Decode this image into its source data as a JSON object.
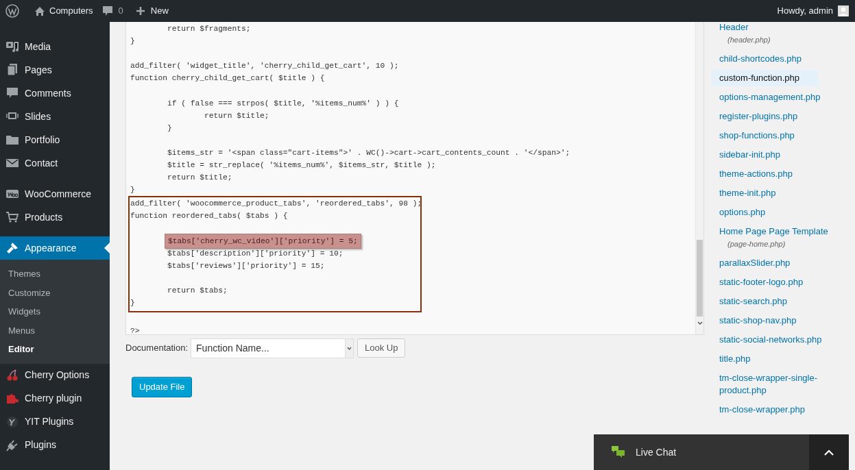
{
  "admin_bar": {
    "site": "Computers",
    "comments": "0",
    "new": "New",
    "greeting": "Howdy, admin"
  },
  "sidebar": {
    "groups": [
      [
        {
          "label": "Media",
          "selected": false
        },
        {
          "label": "Pages",
          "selected": false
        },
        {
          "label": "Comments",
          "selected": false
        },
        {
          "label": "Slides",
          "selected": false
        },
        {
          "label": "Portfolio",
          "selected": false
        },
        {
          "label": "Contact",
          "selected": false
        }
      ],
      [
        {
          "label": "WooCommerce",
          "selected": false
        },
        {
          "label": "Products",
          "selected": false
        }
      ],
      [
        {
          "label": "Appearance",
          "selected": true,
          "children": [
            {
              "label": "Themes",
              "selected": false
            },
            {
              "label": "Customize",
              "selected": false
            },
            {
              "label": "Widgets",
              "selected": false
            },
            {
              "label": "Menus",
              "selected": false
            },
            {
              "label": "Editor",
              "selected": true
            }
          ]
        },
        {
          "label": "Cherry Options",
          "selected": false
        },
        {
          "label": "Cherry plugin",
          "selected": false
        },
        {
          "label": "YIT Plugins",
          "selected": false
        },
        {
          "label": "Plugins",
          "selected": false
        }
      ]
    ]
  },
  "editor": {
    "lines_before": [
      {
        "kind": "code",
        "text": "\treturn $fragments;"
      },
      {
        "kind": "code",
        "text": "}"
      },
      {
        "kind": "blank"
      },
      {
        "kind": "code",
        "text": "add_filter( 'widget_title', 'cherry_child_get_cart', 10 );"
      },
      {
        "kind": "code",
        "text": "function cherry_child_get_cart( $title ) {"
      },
      {
        "kind": "blank"
      },
      {
        "kind": "code",
        "text": "\tif ( false === strpos( $title, '%items_num%' ) ) {"
      },
      {
        "kind": "code",
        "text": "\t\treturn $title;"
      },
      {
        "kind": "code",
        "text": "\t}"
      },
      {
        "kind": "blank"
      },
      {
        "kind": "code",
        "text": "\t$items_str = '<span class=\"cart-items\">' . WC()->cart->cart_contents_count . '</span>';"
      },
      {
        "kind": "code",
        "text": "\t$title = str_replace( '%items_num%', $items_str, $title );"
      },
      {
        "kind": "code",
        "text": "\treturn $title;"
      },
      {
        "kind": "code",
        "text": "}"
      }
    ],
    "boxed_lines": [
      {
        "kind": "code",
        "text": "add_filter( 'woocommerce_product_tabs', 'reordered_tabs', 98 );",
        "highlighted": false
      },
      {
        "kind": "code",
        "text": "function reordered_tabs( $tabs ) {",
        "highlighted": false
      },
      {
        "kind": "blank"
      },
      {
        "kind": "code",
        "text": "\t$tabs['cherry_wc_video']['priority'] = 5;",
        "highlighted": true
      },
      {
        "kind": "code",
        "text": "\t$tabs['description']['priority'] = 10;",
        "highlighted": false
      },
      {
        "kind": "code",
        "text": "\t$tabs['reviews']['priority'] = 15;",
        "highlighted": false
      },
      {
        "kind": "blank"
      },
      {
        "kind": "code",
        "text": "\treturn $tabs;",
        "highlighted": false
      },
      {
        "kind": "code",
        "text": "}",
        "highlighted": false
      }
    ],
    "lines_after": [
      {
        "kind": "blank"
      },
      {
        "kind": "code",
        "text": "?>"
      }
    ]
  },
  "documentation": {
    "label": "Documentation:",
    "placeholder": "Function Name...",
    "button": "Look Up"
  },
  "update_button": "Update File",
  "files": [
    {
      "name": "Header",
      "sub": "(header.php)",
      "selected": false
    },
    {
      "name": "child-shortcodes.php",
      "selected": false
    },
    {
      "name": "custom-function.php",
      "selected": true
    },
    {
      "name": "options-management.php",
      "selected": false
    },
    {
      "name": "register-plugins.php",
      "selected": false
    },
    {
      "name": "shop-functions.php",
      "selected": false
    },
    {
      "name": "sidebar-init.php",
      "selected": false
    },
    {
      "name": "theme-actions.php",
      "selected": false
    },
    {
      "name": "theme-init.php",
      "selected": false
    },
    {
      "name": "options.php",
      "selected": false
    },
    {
      "name": "Home Page Page Template",
      "sub": "(page-home.php)",
      "selected": false
    },
    {
      "name": "parallaxSlider.php",
      "selected": false
    },
    {
      "name": "static-footer-logo.php",
      "selected": false
    },
    {
      "name": "static-search.php",
      "selected": false
    },
    {
      "name": "static-shop-nav.php",
      "selected": false
    },
    {
      "name": "static-social-networks.php",
      "selected": false
    },
    {
      "name": "title.php",
      "selected": false
    },
    {
      "name": "tm-close-wrapper-single-product.php",
      "selected": false
    },
    {
      "name": "tm-close-wrapper.php",
      "selected": false
    }
  ],
  "live_chat": {
    "label": "Live Chat"
  }
}
